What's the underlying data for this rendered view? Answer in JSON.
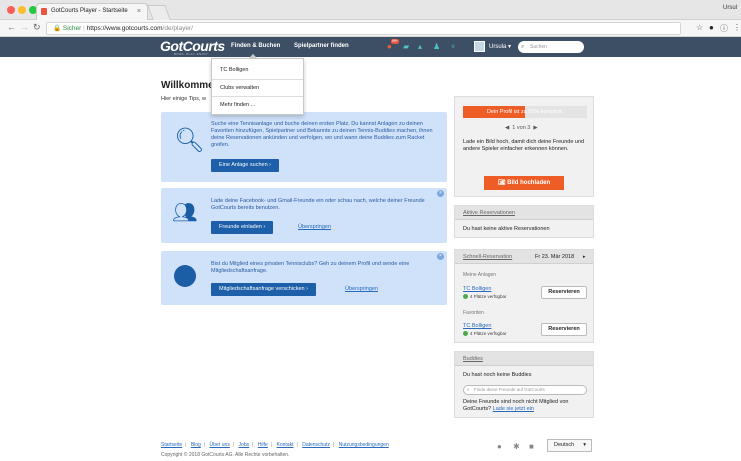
{
  "browser": {
    "tab_title": "GotCourts Player - Startseite",
    "tab_close": "×",
    "profile_name": "Ursul",
    "url_secure": "Sicher",
    "url_host": "https://www.gotcourts.com",
    "url_path": "/de/player/",
    "colors": {
      "close": "#fc5f57",
      "min": "#fdbc2e",
      "max": "#28c840"
    }
  },
  "nav": {
    "logo": "GotCourts",
    "logo_sub": "BOOK. PLAY. ENJOY.",
    "links": [
      "Finden & Buchen",
      "Spielpartner finden"
    ],
    "notification_count": "99+",
    "user": "Ursula",
    "search_placeholder": "Suchen"
  },
  "dropdown": {
    "items": [
      "TC Bolligen",
      "Clubs verwalten",
      "Mehr finden ..."
    ]
  },
  "welcome": {
    "title": "Willkommen",
    "intro": "Hier einige Tips, w"
  },
  "cards": [
    {
      "text": "Suche eine Tennisanlage und buche deinen ersten Platz. Du kannst Anlagen zu deinen Favoriten hinzufügen, Spielpartner und Bekannte zu deinen Tennis-Buddies machen, ihnen deine Reservationen ankünden und verfolgen, wo und wann deine Buddies zum Racket greifen.",
      "button": "Eine Anlage suchen  ›"
    },
    {
      "text": "Lade deine Facebook- und Gmail-Freunde ein oder schau nach, welche deiner Freunde GotCourts bereits benutzen.",
      "button": "Freunde einladen  ›",
      "skip": "Überspringen"
    },
    {
      "text": "Bist du Mitglied eines privaten Tennisclubs? Geh zu deinem Profil und sende eine Mitgliedschaftsanfrage.",
      "button": "Mitgliedschaftsanfrage verschicken  ›",
      "skip": "Überspringen"
    }
  ],
  "profile_panel": {
    "progress_text": "Dein Profil ist zu 50% komplett.",
    "progress": 0.5,
    "pager": "1 von 3",
    "text": "Lade ein Bild hoch, damit dich deine Freunde und andere Spieler einfacher erkennen können.",
    "upload_button": "Bild hochladen"
  },
  "reservations": {
    "title": "Aktive Reservationen",
    "empty": "Du hast keine aktive Reservationen"
  },
  "quick": {
    "title": "Schnell-Reservation",
    "date": "Fr 23. Mär 2018",
    "my_label": "Meine Anlagen",
    "fav_label": "Favoriten",
    "club": "TC Bolligen",
    "avail": "4 Plätze verfügbar",
    "reserve": "Reservieren"
  },
  "buddies": {
    "title": "Buddies",
    "empty": "Du hast noch keine Buddies",
    "search_placeholder": "Finde deine Freunde auf GotCourts",
    "text": "Deine Freunde sind noch nicht Mitglied von GotCourts?",
    "invite_link": "Lade sie jetzt ein"
  },
  "footer": {
    "links": [
      "Startseite",
      "Blog",
      "Über uns",
      "Jobs",
      "Hilfe",
      "Kontakt",
      "Datenschutz",
      "Nutzungsbedingungen"
    ],
    "copyright": "Copyright © 2018 GotCourts AG. Alle Rechte vorbehalten.",
    "language": "Deutsch"
  }
}
